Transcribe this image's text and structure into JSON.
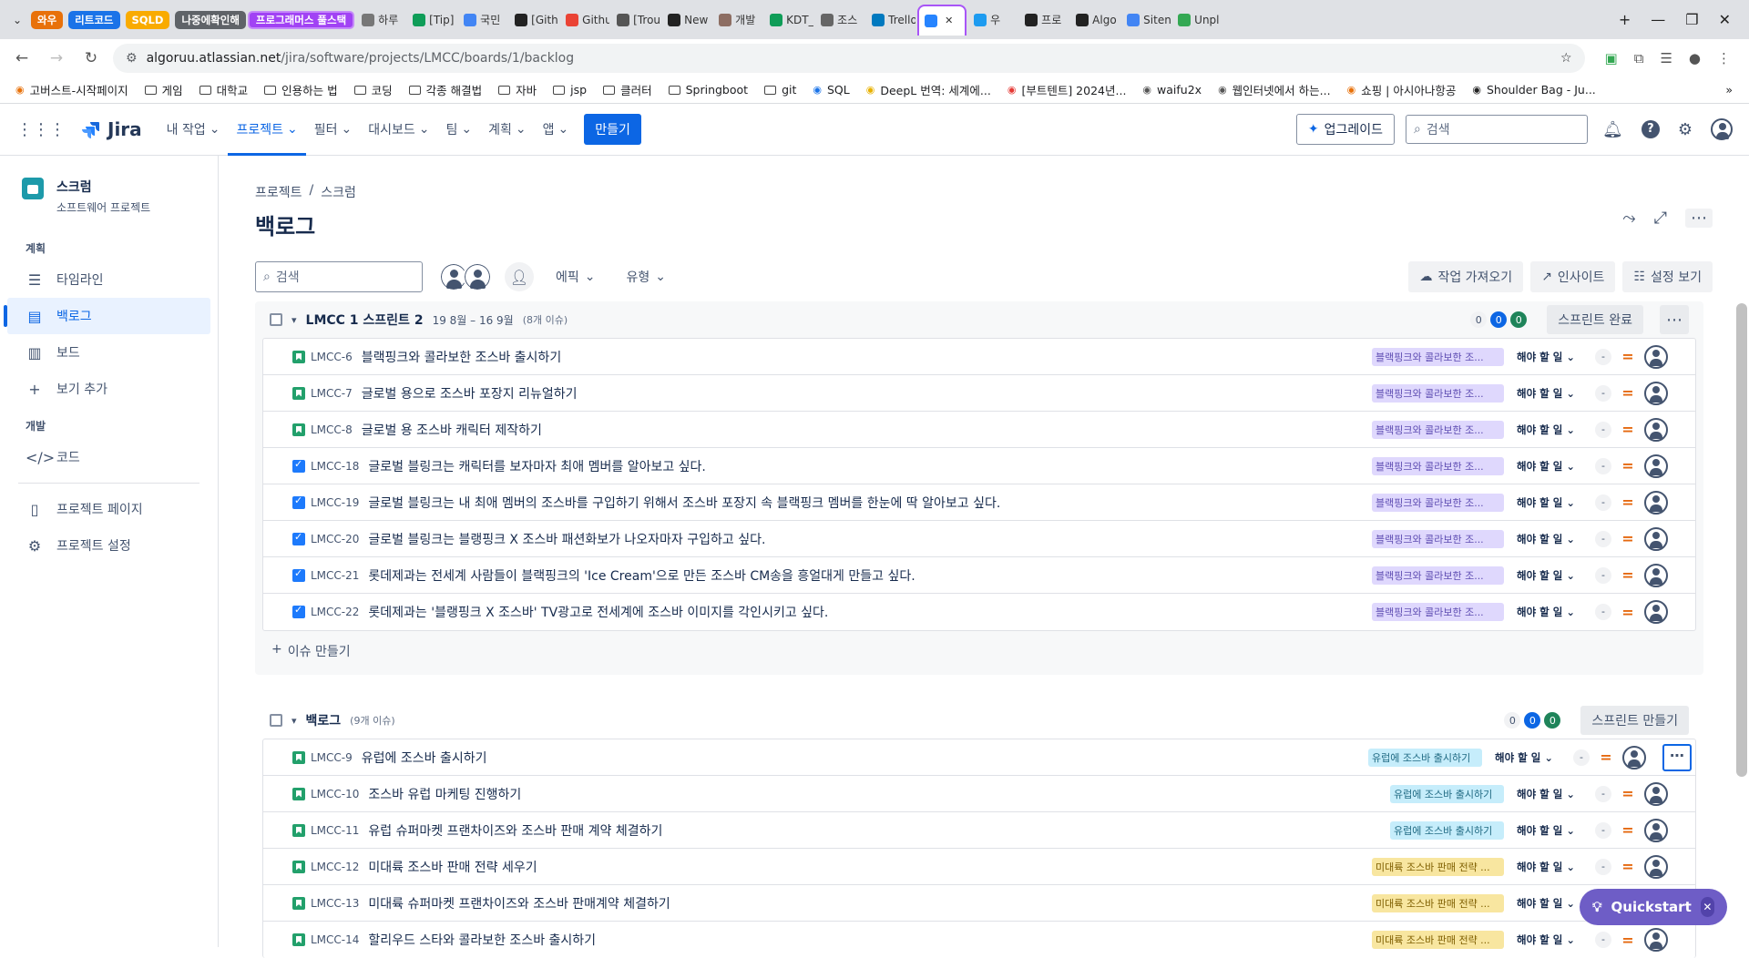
{
  "browser": {
    "group_tabs": [
      {
        "label": "와우",
        "color": "#e8710a"
      },
      {
        "label": "리트코드",
        "color": "#1a73e8"
      },
      {
        "label": "SQLD",
        "color": "#f9ab00"
      },
      {
        "label": "나중에확인해",
        "color": "#5f6368"
      }
    ],
    "tabs": [
      "하루",
      "[Tip]",
      "국민",
      "[Gith",
      "Githu",
      "[Trou",
      "New",
      "개발",
      "KDT_",
      "조스",
      "Trello",
      "",
      "우",
      "프로",
      "Algo",
      "Siten",
      "Unpl"
    ],
    "highlight_tab": "프로그래머스 풀스택",
    "url_host": "algoruu.atlassian.net",
    "url_path": "/jira/software/projects/LMCC/boards/1/backlog",
    "bookmarks": [
      "고버스트-시작페이지",
      "게임",
      "대학교",
      "인용하는 법",
      "코딩",
      "각종 해결법",
      "자바",
      "jsp",
      "클러터",
      "Springboot",
      "git",
      "SQL",
      "DeepL 번역: 세계에...",
      "[부트텐트] 2024년...",
      "waifu2x",
      "웹인터넷에서 하는...",
      "쇼핑 | 아시아나항공",
      "Shoulder Bag - Ju..."
    ]
  },
  "jira": {
    "logo": "Jira",
    "nav": [
      "내 작업",
      "프로젝트",
      "필터",
      "대시보드",
      "팀",
      "계획",
      "앱"
    ],
    "create": "만들기",
    "upgrade": "업그레이드",
    "search_placeholder": "검색"
  },
  "sidebar": {
    "project_name": "스크럼",
    "project_type": "소프트웨어 프로젝트",
    "plan_heading": "계획",
    "dev_heading": "개발",
    "items": [
      "타임라인",
      "백로그",
      "보드",
      "보기 추가",
      "코드",
      "프로젝트 페이지",
      "프로젝트 설정"
    ]
  },
  "main": {
    "breadcrumb": [
      "프로젝트",
      "/",
      "스크럼"
    ],
    "title": "백로그",
    "search_placeholder": "검색",
    "filters": [
      "에픽",
      "유형"
    ],
    "tools": [
      "작업 가져오기",
      "인사이트",
      "설정 보기"
    ],
    "create_issue": "이슈 만들기"
  },
  "sprint": {
    "name": "LMCC 1 스프린트 2",
    "dates": "19 8월 – 16 9월",
    "count": "(8개 이슈)",
    "points": [
      "0",
      "0",
      "0"
    ],
    "action": "스프린트 완료",
    "issues": [
      {
        "key": "LMCC-6",
        "type": "story",
        "summary": "블랙핑크와 콜라보한 조스바 출시하기",
        "epic": "블랙핑크와 콜라보한 조...",
        "epic_color": "purple",
        "status": "해야 할 일"
      },
      {
        "key": "LMCC-7",
        "type": "story",
        "summary": "글로벌 용으로 조스바 포장지 리뉴얼하기",
        "epic": "블랙핑크와 콜라보한 조...",
        "epic_color": "purple",
        "status": "해야 할 일"
      },
      {
        "key": "LMCC-8",
        "type": "story",
        "summary": "글로벌 용 조스바 캐릭터 제작하기",
        "epic": "블랙핑크와 콜라보한 조...",
        "epic_color": "purple",
        "status": "해야 할 일"
      },
      {
        "key": "LMCC-18",
        "type": "task",
        "summary": "글로벌 블링크는 캐릭터를 보자마자 최애 멤버를 알아보고 싶다.",
        "epic": "블랙핑크와 콜라보한 조...",
        "epic_color": "purple",
        "status": "해야 할 일"
      },
      {
        "key": "LMCC-19",
        "type": "task",
        "summary": "글로벌 블링크는 내 최애 멤버의 조스바를 구입하기 위해서 조스바 포장지 속 블랙핑크 멤버를 한눈에 딱 알아보고 싶다.",
        "epic": "블랙핑크와 콜라보한 조...",
        "epic_color": "purple",
        "status": "해야 할 일"
      },
      {
        "key": "LMCC-20",
        "type": "task",
        "summary": "글로벌 블링크는 블랭핑크 X 조스바 패션화보가 나오자마자 구입하고 싶다.",
        "epic": "블랙핑크와 콜라보한 조...",
        "epic_color": "purple",
        "status": "해야 할 일"
      },
      {
        "key": "LMCC-21",
        "type": "task",
        "summary": "롯데제과는 전세계 사람들이 블랙핑크의 'Ice Cream'으로 만든 조스바 CM송을 흥얼대게 만들고 싶다.",
        "epic": "블랙핑크와 콜라보한 조...",
        "epic_color": "purple",
        "status": "해야 할 일"
      },
      {
        "key": "LMCC-22",
        "type": "task",
        "summary": "롯데제과는 '블랭핑크 X 조스바' TV광고로 전세계에 조스바 이미지를 각인시키고 싶다.",
        "epic": "블랙핑크와 콜라보한 조...",
        "epic_color": "purple",
        "status": "해야 할 일"
      }
    ]
  },
  "backlog": {
    "name": "백로그",
    "count": "(9개 이슈)",
    "points": [
      "0",
      "0",
      "0"
    ],
    "action": "스프린트 만들기",
    "issues": [
      {
        "key": "LMCC-9",
        "type": "story",
        "summary": "유럽에 조스바 출시하기",
        "epic": "유럽에 조스바 출시하기",
        "epic_color": "cyan",
        "status": "해야 할 일"
      },
      {
        "key": "LMCC-10",
        "type": "story",
        "summary": "조스바 유럽 마케팅 진행하기",
        "epic": "유럽에 조스바 출시하기",
        "epic_color": "cyan",
        "status": "해야 할 일"
      },
      {
        "key": "LMCC-11",
        "type": "story",
        "summary": "유럽 슈퍼마켓 프랜차이즈와 조스바 판매 계약 체결하기",
        "epic": "유럽에 조스바 출시하기",
        "epic_color": "cyan",
        "status": "해야 할 일"
      },
      {
        "key": "LMCC-12",
        "type": "story",
        "summary": "미대륙 조스바 판매 전략 세우기",
        "epic": "미대륙 조스바 판매 전략 ...",
        "epic_color": "yellow",
        "status": "해야 할 일"
      },
      {
        "key": "LMCC-13",
        "type": "story",
        "summary": "미대륙 슈퍼마켓 프랜차이즈와 조스바 판매계약 체결하기",
        "epic": "미대륙 조스바 판매 전략 ...",
        "epic_color": "yellow",
        "status": "해야 할 일"
      },
      {
        "key": "LMCC-14",
        "type": "story",
        "summary": "할리우드 스타와 콜라보한 조스바 출시하기",
        "epic": "미대륙 조스바 판매 전략 ...",
        "epic_color": "yellow",
        "status": "해야 할 일"
      }
    ]
  },
  "quickstart": "Quickstart"
}
